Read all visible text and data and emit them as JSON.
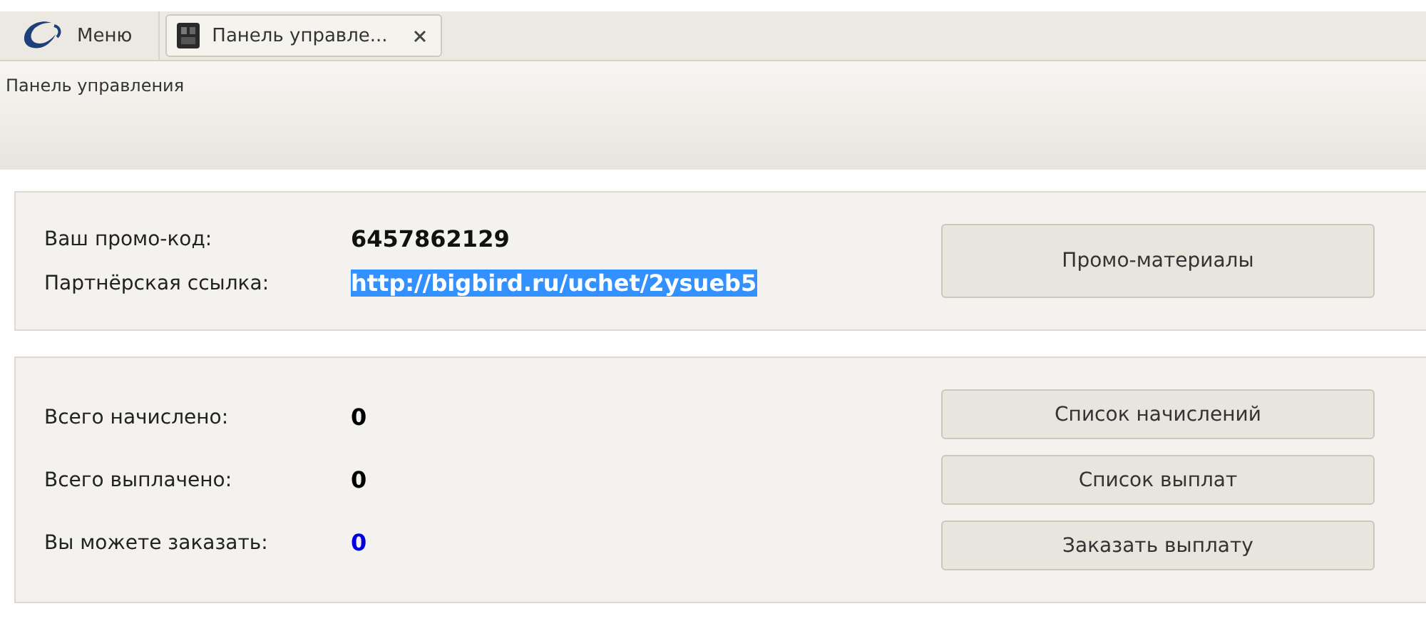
{
  "menu": {
    "label": "Меню"
  },
  "tabs": [
    {
      "label": "Панель управле...",
      "selected": true
    }
  ],
  "page_title": "Панель управления",
  "promo": {
    "fields": [
      {
        "label": "Ваш промо-код:",
        "value": "6457862129",
        "kind": "text",
        "selected": false
      },
      {
        "label": "Партнёрская ссылка:",
        "value": "http://bigbird.ru/uchet/2ysueb5",
        "kind": "link",
        "selected": true
      }
    ],
    "button": "Промо-материалы"
  },
  "stats": {
    "rows": [
      {
        "label": "Всего начислено:",
        "value": "0",
        "color": "#000000"
      },
      {
        "label": "Всего выплачено:",
        "value": "0",
        "color": "#000000"
      },
      {
        "label": "Вы можете заказать:",
        "value": "0",
        "color": "#0000e0"
      }
    ],
    "buttons": [
      "Список начислений",
      "Список выплат",
      "Заказать выплату"
    ]
  }
}
